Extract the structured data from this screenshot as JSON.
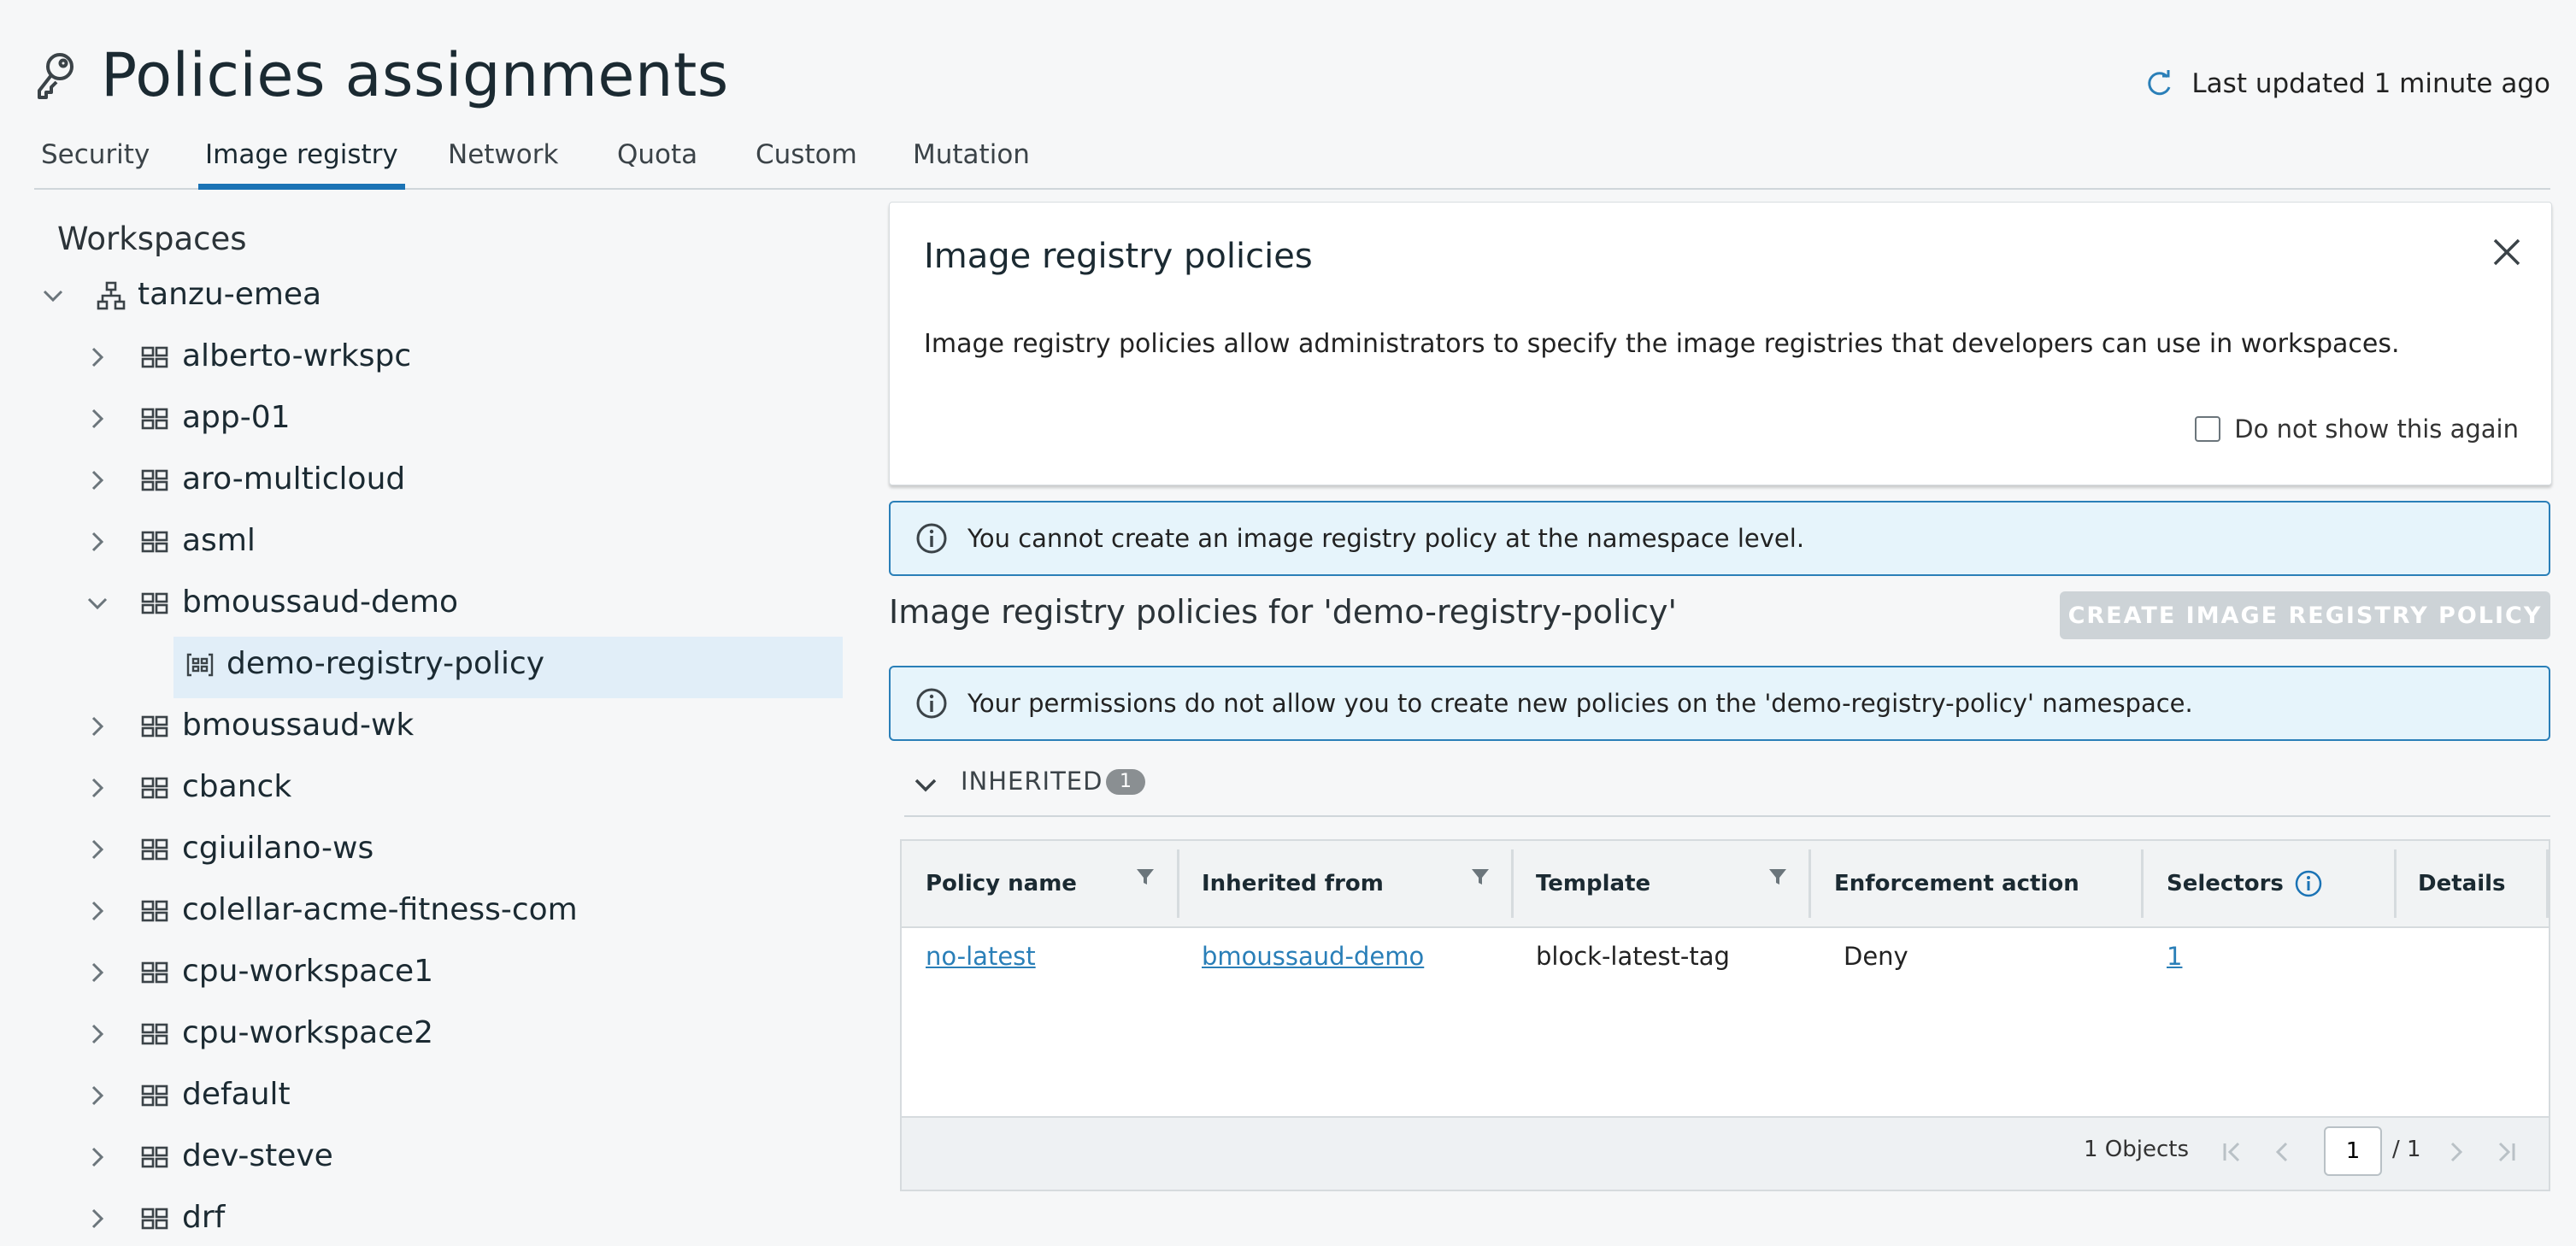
{
  "header": {
    "title": "Policies assignments",
    "last_updated": "Last updated 1 minute ago"
  },
  "tabs": [
    {
      "label": "Security",
      "active": false
    },
    {
      "label": "Image registry",
      "active": true
    },
    {
      "label": "Network",
      "active": false
    },
    {
      "label": "Quota",
      "active": false
    },
    {
      "label": "Custom",
      "active": false
    },
    {
      "label": "Mutation",
      "active": false
    }
  ],
  "tree": {
    "heading": "Workspaces",
    "root": {
      "label": "tanzu-emea",
      "expanded": true
    },
    "items": [
      {
        "label": "alberto-wrkspc",
        "expanded": false
      },
      {
        "label": "app-01",
        "expanded": false
      },
      {
        "label": "aro-multicloud",
        "expanded": false
      },
      {
        "label": "asml",
        "expanded": false
      },
      {
        "label": "bmoussaud-demo",
        "expanded": true
      },
      {
        "label": "demo-registry-policy",
        "namespace": true,
        "selected": true
      },
      {
        "label": "bmoussaud-wk",
        "expanded": false
      },
      {
        "label": "cbanck",
        "expanded": false
      },
      {
        "label": "cgiuilano-ws",
        "expanded": false
      },
      {
        "label": "colellar-acme-fitness-com",
        "expanded": false
      },
      {
        "label": "cpu-workspace1",
        "expanded": false
      },
      {
        "label": "cpu-workspace2",
        "expanded": false
      },
      {
        "label": "default",
        "expanded": false
      },
      {
        "label": "dev-steve",
        "expanded": false
      },
      {
        "label": "drf",
        "expanded": false
      }
    ]
  },
  "info_card": {
    "title": "Image registry policies",
    "description": "Image registry policies allow administrators to specify the image registries that developers can use in workspaces.",
    "checkbox_label": "Do not show this again"
  },
  "alerts": {
    "namespace_level": "You cannot create an image registry policy at the namespace level.",
    "permissions": "Your permissions do not allow you to create new policies on the 'demo-registry-policy' namespace."
  },
  "section": {
    "title": "Image registry policies for 'demo-registry-policy'",
    "create_button": "CREATE IMAGE REGISTRY POLICY"
  },
  "inherited": {
    "label": "INHERITED",
    "count": "1"
  },
  "table": {
    "columns": [
      "Policy name",
      "Inherited from",
      "Template",
      "Enforcement action",
      "Selectors",
      "Details"
    ],
    "rows": [
      {
        "policy_name": "no-latest",
        "inherited_from": "bmoussaud-demo",
        "template": "block-latest-tag",
        "enforcement_action": "Deny",
        "selectors": "1",
        "details": ""
      }
    ],
    "footer": {
      "count": "1 Objects",
      "page": "1",
      "total": "/ 1"
    }
  },
  "colors": {
    "accent": "#1b73b5",
    "link": "#2a7fb8",
    "alert_bg": "#e6f4fb",
    "selected_bg": "#e1eef8"
  }
}
